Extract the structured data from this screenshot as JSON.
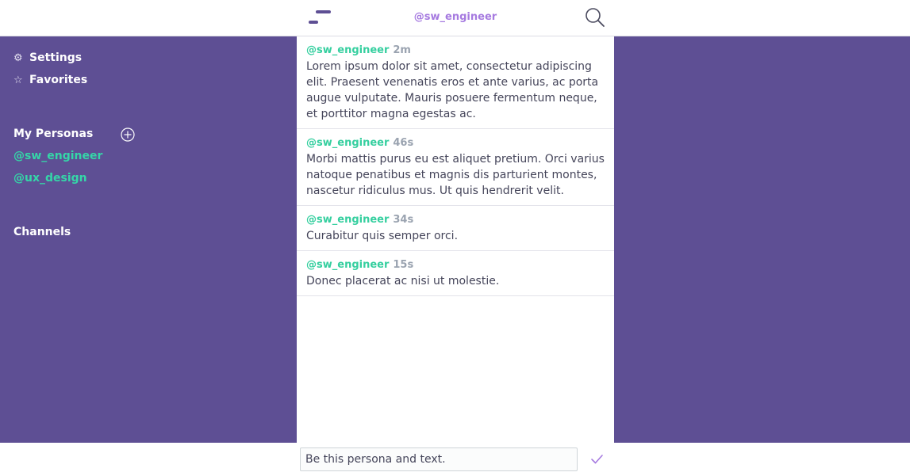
{
  "header": {
    "title": "@sw_engineer",
    "logo_icon": "logo-dashes-icon",
    "search_icon": "search-icon"
  },
  "sidebar": {
    "items": [
      {
        "label": "Settings",
        "icon": "gear-icon",
        "glyph": "⚙"
      },
      {
        "label": "Favorites",
        "icon": "star-icon",
        "glyph": "☆"
      }
    ],
    "personas_heading": "My Personas",
    "add_icon": "plus-circle-icon",
    "personas": [
      "@sw_engineer",
      "@ux_design"
    ],
    "channels_heading": "Channels"
  },
  "posts": [
    {
      "user": "@sw_engineer",
      "time": "2m",
      "text": "Lorem ipsum dolor sit amet, consectetur adipiscing elit. Praesent venenatis eros et ante varius, ac porta augue vulputate. Mauris posuere fermentum neque, et porttitor magna egestas ac."
    },
    {
      "user": "@sw_engineer",
      "time": "46s",
      "text": "Morbi mattis purus eu est aliquet pretium. Orci varius natoque penatibus et magnis dis parturient montes, nascetur ridiculus mus. Ut quis hendrerit velit."
    },
    {
      "user": "@sw_engineer",
      "time": "34s",
      "text": "Curabitur quis semper orci."
    },
    {
      "user": "@sw_engineer",
      "time": "15s",
      "text": "Donec placerat ac nisi ut molestie."
    }
  ],
  "composer": {
    "value": "Be this persona and text.",
    "send_icon": "checkmark-icon"
  },
  "colors": {
    "background": "#5e4f94",
    "accent_green": "#35cf9f",
    "accent_purple": "#a67ae0"
  }
}
